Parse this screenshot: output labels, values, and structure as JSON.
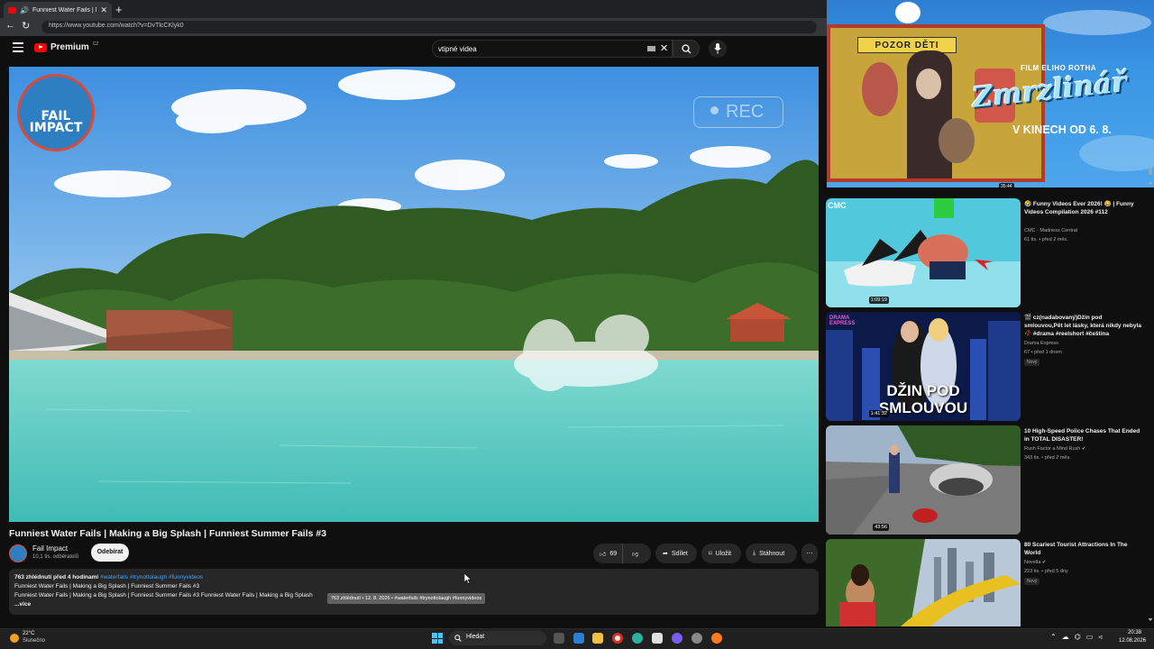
{
  "browser": {
    "tab_title": "Funniest Water Fails | Making",
    "url": "https://www.youtube.com/watch?v=DvTlcCKlyk0"
  },
  "youtube": {
    "logo_text": "Premium",
    "logo_country": "CZ",
    "search_query": "vtipné videa"
  },
  "video": {
    "overlay_rec": "REC",
    "channel_logo_text": "FAIL IMPACT",
    "title": "Funniest Water Fails | Making a Big Splash | Funniest Summer Fails #3",
    "channel_name": "Fail Impact",
    "subscribers": "10,1 tis. odběratelů",
    "subscribe_label": "Odebírat",
    "like_count": "69",
    "share_label": "Sdílet",
    "save_label": "Uložit",
    "download_label": "Stáhnout",
    "description": {
      "stats": "763 zhlédnutí  před 4 hodinami",
      "tags": "#waterfails #trynottolaugh #funnyvideos",
      "line2": "Funniest Water Fails | Making a Big Splash | Funniest Summer Fails #3",
      "line3": "Funniest Water Fails | Making a Big Splash | Funniest Summer Fails #3 Funniest Water Fails | Making a Big Splash",
      "more": "...více"
    },
    "tooltip": "763 zhlédnutí • 12. 8. 2026 • #waterfails #trynottolaugh #funnyvideos"
  },
  "ad": {
    "sign_text": "POZOR DĚTI",
    "film_line": "FILM ELIHO ROTHA",
    "brand": "Zmrzlinář",
    "date_line": "V KINECH OD 6. 8.",
    "duration": "35:44"
  },
  "recommendations": [
    {
      "title": "🤣 Funny Videos Ever 2026! 😂 | Funny Videos Compilation 2026 #112",
      "channel": "CMC - Madness Central",
      "meta": "61 tis. • před 2 měs.",
      "duration": "1:09:19",
      "badge": ""
    },
    {
      "title": "🎬 cz(nadabovaný)Džin pod smlouvou,Pět let lásky, která nikdy nebyla🥀 #drama #reelshort #čeština",
      "channel": "Drama Express",
      "meta": "67 • před 1 dnem",
      "duration": "1:41:32",
      "badge": "Nový"
    },
    {
      "title": "10 High-Speed Police Chases That Ended in TOTAL DISASTER!",
      "channel": "Rush Factor a Mind Rush ✔",
      "meta": "343 tis. • před 2 měs.",
      "duration": "43:56",
      "badge": ""
    },
    {
      "title": "80 Scariest Tourist Attractions In The World",
      "channel": "Novella ✔",
      "meta": "223 tis. • před 5 dny",
      "duration": "",
      "badge": "Nový"
    }
  ],
  "thumb_texts": {
    "cmc_logo": "CMC",
    "drama_logo": "DRAMA EXPRESS",
    "drama_title": "DŽIN POD SMLOUVOU"
  },
  "taskbar": {
    "weather_temp": "22°C",
    "weather_desc": "Slunečno",
    "search_label": "Hledat",
    "time": "20:38",
    "date": "12.08.2026"
  },
  "colors": {
    "yt_red": "#ff0000",
    "link_blue": "#3ea6ff",
    "water": "#5fd0c7"
  }
}
